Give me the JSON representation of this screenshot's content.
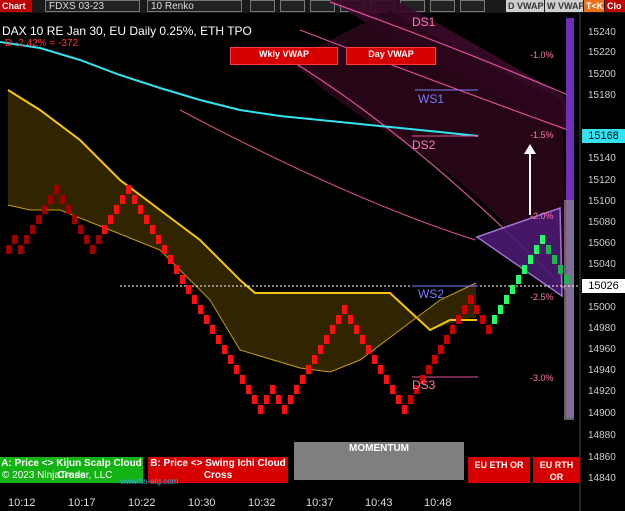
{
  "topbar": {
    "chart_tab": "Chart",
    "instrument": "FDXS 03-23",
    "interval": "10 Renko",
    "buttons": [
      "D VWAP",
      "W VWAP",
      "T<K",
      "Clo"
    ]
  },
  "header": {
    "title": "DAX 10  RE Jan 30, EU Daily 0.25%, ETH TPO",
    "change": "D -2.42% = -372"
  },
  "vwap_buttons": {
    "weekly": "Wkly VWAP",
    "daily": "Day VWAP"
  },
  "levels": {
    "ds1": "DS1",
    "ws1": "WS1",
    "ds2": "DS2",
    "ws2": "WS2",
    "ds3": "DS3"
  },
  "percent_labels": [
    "-1.0%",
    "-1.5%",
    "-2.0%",
    "-2.5%",
    "-3.0%"
  ],
  "y_axis": {
    "ticks": [
      "15240",
      "15220",
      "15200",
      "15180",
      "15140",
      "15120",
      "15100",
      "15080",
      "15060",
      "15040",
      "15000",
      "14980",
      "14960",
      "14940",
      "14920",
      "14900",
      "14880",
      "14860",
      "14840"
    ],
    "price_tag_cyan": "15168",
    "price_tag_white": "15026"
  },
  "x_axis": {
    "ticks": [
      "10:12",
      "10:17",
      "10:22",
      "10:30",
      "10:32",
      "10:37",
      "10:43",
      "10:48"
    ]
  },
  "bottom_buttons": {
    "kijun": "A: Price <> Kijun Scalp Cloud Cross",
    "ichi": "B: Price <> Swing Ichi Cloud Cross",
    "momentum": "MOMENTUM",
    "eu_eth": "EU ETH OR",
    "eu_rth": "EU RTH OR"
  },
  "footer": {
    "copyright": "© 2023 NinjaTrader, LLC",
    "watermark": "www.fin-alg.com"
  },
  "colors": {
    "cyan": "#33e3f0",
    "gold": "#f5c60a",
    "red": "#ff1010",
    "green": "#22ff66",
    "pink": "#e04f9a",
    "purple": "#8a3fd1",
    "panel_red": "#d60000",
    "panel_green": "#12b312"
  },
  "chart_data": {
    "type": "renko",
    "brick_size": 10,
    "ylim": [
      14835,
      15255
    ],
    "last_price": 15026,
    "vwap_price": 15168
  }
}
